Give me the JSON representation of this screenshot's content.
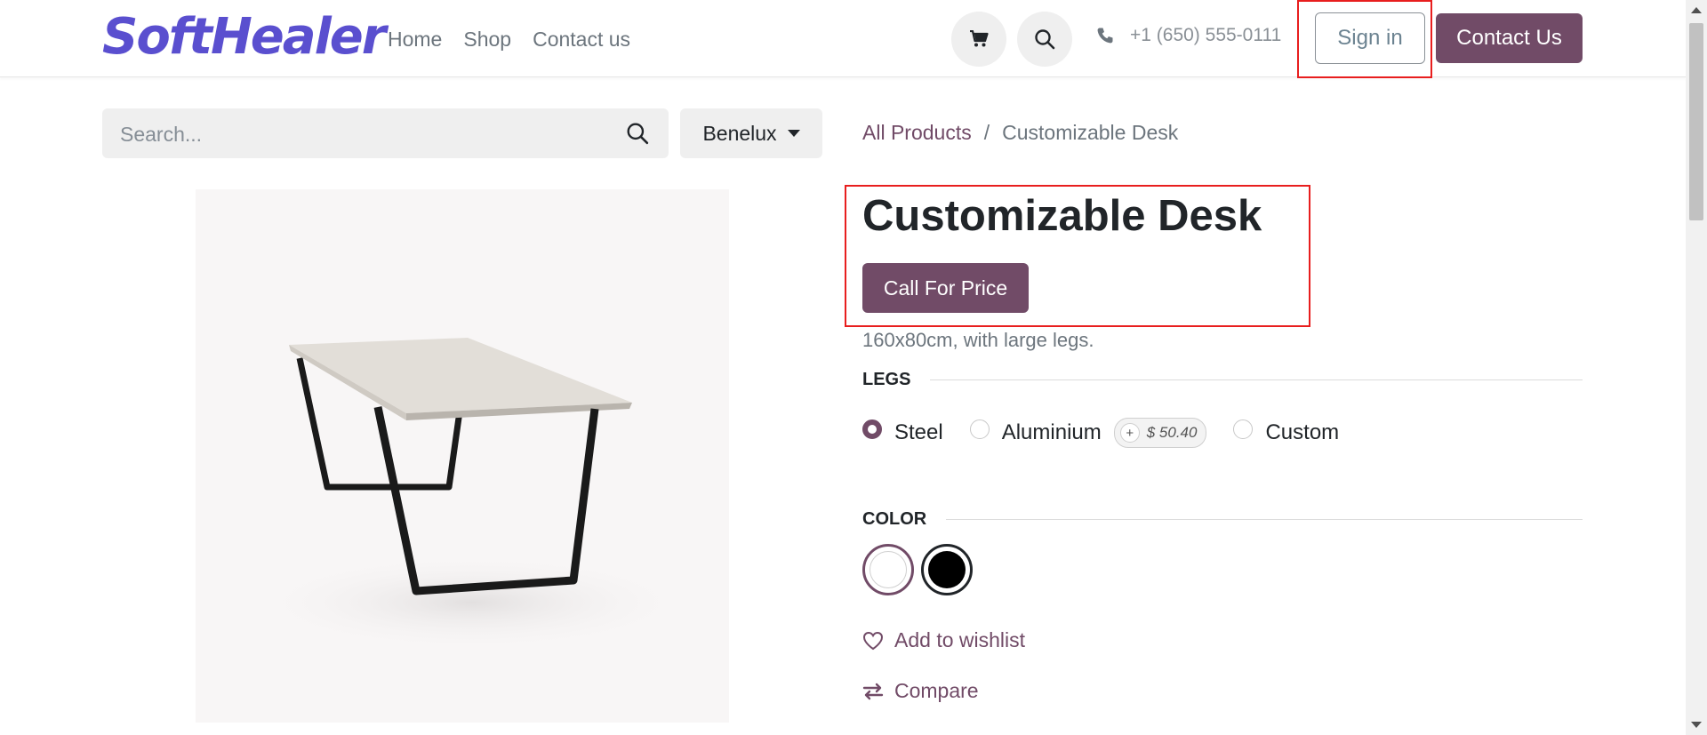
{
  "header": {
    "logo_text": "SoftHealer",
    "nav": [
      "Home",
      "Shop",
      "Contact us"
    ],
    "phone": "+1 (650) 555-0111",
    "sign_in": "Sign in",
    "contact_us": "Contact Us"
  },
  "search": {
    "placeholder": "Search...",
    "pricelist": "Benelux"
  },
  "breadcrumb": {
    "parent": "All Products",
    "separator": "/",
    "current": "Customizable Desk"
  },
  "product": {
    "title": "Customizable Desk",
    "call_for_price": "Call For Price",
    "description": "160x80cm, with large legs."
  },
  "attributes": {
    "legs": {
      "label": "LEGS",
      "options": [
        {
          "label": "Steel",
          "selected": true
        },
        {
          "label": "Aluminium",
          "selected": false,
          "extra_sign": "+",
          "extra_price": "$ 50.40"
        },
        {
          "label": "Custom",
          "selected": false
        }
      ]
    },
    "color": {
      "label": "COLOR",
      "swatches": [
        {
          "name": "White",
          "hex": "#ffffff",
          "selected": true
        },
        {
          "name": "Black",
          "hex": "#000000",
          "selected": false
        }
      ]
    }
  },
  "actions": {
    "wishlist": "Add to wishlist",
    "compare": "Compare"
  },
  "colors": {
    "brand": "#714b67",
    "logo": "#5a4fcf",
    "highlight": "#e81e1e"
  },
  "icons": [
    "cart-icon",
    "search-icon",
    "phone-icon",
    "heart-icon",
    "compare-icon"
  ]
}
